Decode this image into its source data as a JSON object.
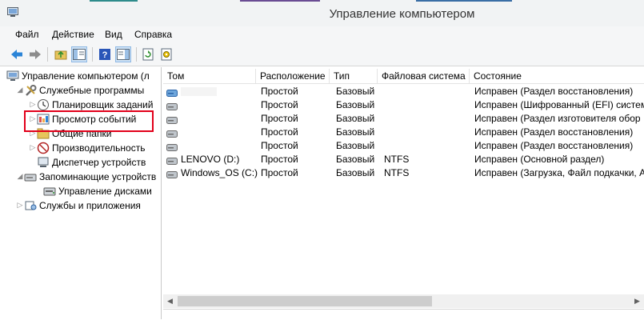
{
  "window": {
    "title": "Управление компьютером"
  },
  "menu": [
    "Файл",
    "Действие",
    "Вид",
    "Справка"
  ],
  "tree": {
    "root": "Управление компьютером (л",
    "utilities": "Служебные программы",
    "task_scheduler": "Планировщик заданий",
    "event_viewer": "Просмотр событий",
    "shared_folders": "Общие папки",
    "performance": "Производительность",
    "device_manager": "Диспетчер устройств",
    "storage": "Запоминающие устройств",
    "disk_management": "Управление дисками",
    "services": "Службы и приложения"
  },
  "table": {
    "columns": [
      "Том",
      "Расположение",
      "Тип",
      "Файловая система",
      "Состояние"
    ],
    "rows": [
      {
        "volume": "",
        "layout": "Простой",
        "type": "Базовый",
        "fs": "",
        "status": "Исправен (Раздел восстановления)",
        "icon": "disk-blue"
      },
      {
        "volume": "",
        "layout": "Простой",
        "type": "Базовый",
        "fs": "",
        "status": "Исправен (Шифрованный (EFI) систем",
        "icon": "disk-gray"
      },
      {
        "volume": "",
        "layout": "Простой",
        "type": "Базовый",
        "fs": "",
        "status": "Исправен (Раздел изготовителя обор",
        "icon": "disk-gray"
      },
      {
        "volume": "",
        "layout": "Простой",
        "type": "Базовый",
        "fs": "",
        "status": "Исправен (Раздел восстановления)",
        "icon": "disk-gray"
      },
      {
        "volume": "",
        "layout": "Простой",
        "type": "Базовый",
        "fs": "",
        "status": "Исправен (Раздел восстановления)",
        "icon": "disk-gray"
      },
      {
        "volume": "LENOVO (D:)",
        "layout": "Простой",
        "type": "Базовый",
        "fs": "NTFS",
        "status": "Исправен (Основной раздел)",
        "icon": "disk-gray"
      },
      {
        "volume": "Windows_OS (C:)",
        "layout": "Простой",
        "type": "Базовый",
        "fs": "NTFS",
        "status": "Исправен (Загрузка, Файл подкачки, А",
        "icon": "disk-gray"
      }
    ]
  },
  "colors": {
    "highlight": "#e2001a",
    "accent": "#1979ca"
  }
}
